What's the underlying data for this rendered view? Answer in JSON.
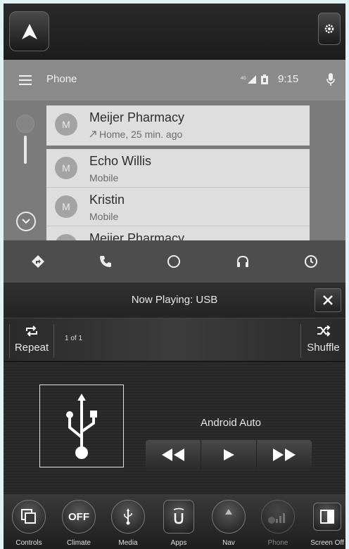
{
  "aa": {
    "title": "Phone",
    "time": "9:15",
    "signal_label": "4G"
  },
  "recent": {
    "name": "Meijer Pharmacy",
    "detail": "Home, 25 min. ago",
    "avatar": "M"
  },
  "contacts": [
    {
      "name": "Echo Willis",
      "detail": "Mobile",
      "avatar": "M"
    },
    {
      "name": "Kristin",
      "detail": "Mobile",
      "avatar": "M"
    },
    {
      "name": "Meijer Pharmacy",
      "detail": "",
      "avatar": "M"
    }
  ],
  "now_playing": {
    "title": "Now Playing: USB",
    "repeat_label": "Repeat",
    "shuffle_label": "Shuffle",
    "count": "1 of 1",
    "track": "Android Auto"
  },
  "dock": {
    "controls": "Controls",
    "climate": "Climate",
    "climate_icon_text": "OFF",
    "media": "Media",
    "apps": "Apps",
    "nav": "Nav",
    "phone": "Phone",
    "screen_off": "Screen Off"
  },
  "colors": {
    "background": "#dff2f4",
    "aa_panel": "#7b7b7b",
    "card": "#dedede"
  }
}
